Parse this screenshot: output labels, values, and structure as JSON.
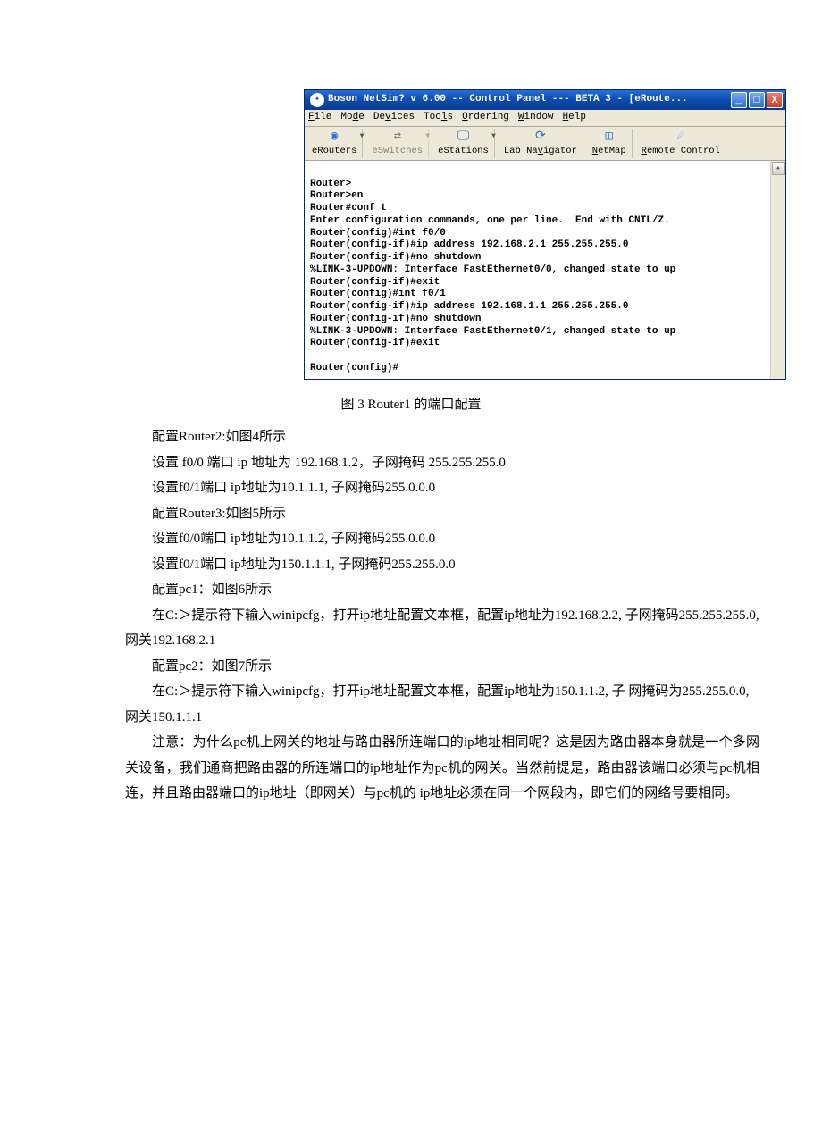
{
  "window": {
    "title": "Boson NetSim? v 6.00 -- Control Panel --- BETA 3 - [eRoute...",
    "menus": {
      "file": "File",
      "mode": "Mode",
      "devices": "Devices",
      "tools": "Tools",
      "ordering": "Ordering",
      "window": "Window",
      "help": "Help"
    },
    "toolbar": {
      "erouters": "eRouters",
      "eswitches": "eSwitches",
      "estations": "eStations",
      "labnav": "Lab Navigator",
      "netmap": "NetMap",
      "remote": "Remote Control"
    },
    "console": "\nRouter>\nRouter>en\nRouter#conf t\nEnter configuration commands, one per line.  End with CNTL/Z.\nRouter(config)#int f0/0\nRouter(config-if)#ip address 192.168.2.1 255.255.255.0\nRouter(config-if)#no shutdown\n%LINK-3-UPDOWN: Interface FastEthernet0/0, changed state to up\nRouter(config-if)#exit\nRouter(config)#int f0/1\nRouter(config-if)#ip address 192.168.1.1 255.255.255.0\nRouter(config-if)#no shutdown\n%LINK-3-UPDOWN: Interface FastEthernet0/1, changed state to up\nRouter(config-if)#exit\n\nRouter(config)#"
  },
  "caption": "图 3 Router1 的端口配置",
  "lines": {
    "l1": "配置Router2:如图4所示",
    "l2": "设置 f0/0 端口 ip 地址为 192.168.1.2，子网掩码 255.255.255.0",
    "l3": "设置f0/1端口 ip地址为10.1.1.1, 子网掩码255.0.0.0",
    "l4": "配置Router3:如图5所示",
    "l5": "设置f0/0端口 ip地址为10.1.1.2, 子网掩码255.0.0.0",
    "l6": "设置f0/1端口 ip地址为150.1.1.1, 子网掩码255.255.0.0",
    "l7": "配置pc1：如图6所示",
    "l8": "在C:＞提示符下输入winipcfg，打开ip地址配置文本框，配置ip地址为192.168.2.2,  子网掩码255.255.255.0, 网关192.168.2.1",
    "l9": "配置pc2：如图7所示",
    "l10": "在C:＞提示符下输入winipcfg，打开ip地址配置文本框，配置ip地址为150.1.1.2, 子 网掩码为255.255.0.0, 网关150.1.1.1",
    "note": "注意：为什么pc机上网关的地址与路由器所连端口的ip地址相同呢？这是因为路由器本身就是一个多网关设备，我们通商把路由器的所连端口的ip地址作为pc机的网关。当然前提是，路由器该端口必须与pc机相连，并且路由器端口的ip地址（即网关）与pc机的 ip地址必须在同一个网段内，即它们的网络号要相同。"
  }
}
